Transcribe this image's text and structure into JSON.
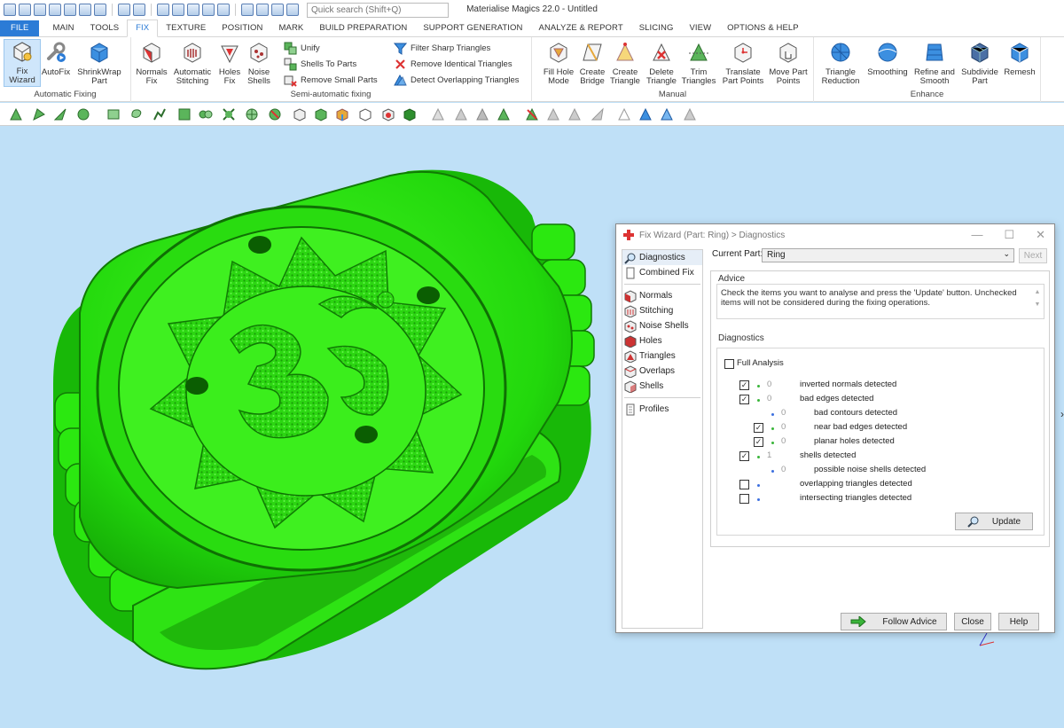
{
  "app": {
    "title": "Materialise Magics 22.0 - Untitled",
    "search_placeholder": "Quick search (Shift+Q)"
  },
  "tabs": [
    "FILE",
    "MAIN",
    "TOOLS",
    "FIX",
    "TEXTURE",
    "POSITION",
    "MARK",
    "BUILD PREPARATION",
    "SUPPORT GENERATION",
    "ANALYZE & REPORT",
    "SLICING",
    "VIEW",
    "OPTIONS & HELP"
  ],
  "active_tab": "FIX",
  "ribbon": {
    "automatic_fixing": {
      "label": "Automatic Fixing",
      "buttons": [
        [
          "Fix",
          "Wizard"
        ],
        [
          "AutoFix",
          ""
        ],
        [
          "ShrinkWrap",
          "Part"
        ]
      ]
    },
    "fix_group": {
      "buttons": [
        [
          "Normals",
          "Fix"
        ],
        [
          "Automatic",
          "Stitching"
        ],
        [
          "Holes",
          "Fix"
        ],
        [
          "Noise",
          "Shells"
        ]
      ]
    },
    "semi_automatic": {
      "label": "Semi-automatic fixing",
      "items": [
        "Unify",
        "Shells To Parts",
        "Remove Small Parts"
      ]
    },
    "filters": {
      "items": [
        "Filter Sharp Triangles",
        "Remove Identical Triangles",
        "Detect Overlapping Triangles"
      ]
    },
    "manual": {
      "label": "Manual",
      "buttons": [
        [
          "Fill Hole",
          "Mode"
        ],
        [
          "Create",
          "Bridge"
        ],
        [
          "Create",
          "Triangle"
        ],
        [
          "Delete",
          "Triangle"
        ],
        [
          "Trim",
          "Triangles"
        ],
        [
          "Translate",
          "Part Points"
        ],
        [
          "Move Part",
          "Points"
        ]
      ]
    },
    "enhance": {
      "label": "Enhance",
      "buttons": [
        [
          "Triangle",
          "Reduction"
        ],
        [
          "Smoothing",
          ""
        ],
        [
          "Refine and",
          "Smooth"
        ],
        [
          "Subdivide",
          "Part"
        ],
        [
          "Remesh",
          ""
        ]
      ]
    }
  },
  "dialog": {
    "title": "Fix Wizard (Part: Ring) > Diagnostics",
    "nav_top": [
      "Diagnostics",
      "Combined Fix"
    ],
    "nav_mid": [
      "Normals",
      "Stitching",
      "Noise Shells",
      "Holes",
      "Triangles",
      "Overlaps",
      "Shells"
    ],
    "nav_bottom": [
      "Profiles"
    ],
    "current_part_label": "Current Part:",
    "current_part_value": "Ring",
    "next_label": "Next",
    "advice_title": "Advice",
    "advice_text": "Check the items you want to analyse and press the 'Update' button. Unchecked items will not be considered during the fixing operations.",
    "diagnostics_title": "Diagnostics",
    "full_analysis": "Full Analysis",
    "rows": [
      {
        "label": "inverted normals detected",
        "count": "0",
        "checked": true,
        "indent": 0
      },
      {
        "label": "bad edges detected",
        "count": "0",
        "checked": true,
        "indent": 0
      },
      {
        "label": "bad contours detected",
        "count": "0",
        "checked": null,
        "indent": 1
      },
      {
        "label": "near bad edges detected",
        "count": "0",
        "checked": true,
        "indent": 1
      },
      {
        "label": "planar holes detected",
        "count": "0",
        "checked": true,
        "indent": 1
      },
      {
        "label": "shells detected",
        "count": "1",
        "checked": true,
        "indent": 0
      },
      {
        "label": "possible noise shells detected",
        "count": "0",
        "checked": null,
        "indent": 1
      },
      {
        "label": "overlapping triangles detected",
        "count": "",
        "checked": false,
        "indent": 0
      },
      {
        "label": "intersecting triangles detected",
        "count": "",
        "checked": false,
        "indent": 0
      }
    ],
    "update_label": "Update",
    "follow_advice_label": "Follow Advice",
    "close_label": "Close",
    "help_label": "Help"
  },
  "colors": {
    "ring": "#22e20a",
    "viewport": "#bfe0f7",
    "accent": "#2b7bd6"
  }
}
